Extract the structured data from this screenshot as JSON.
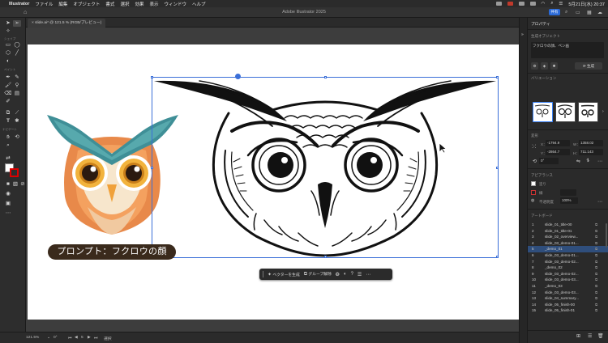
{
  "menubar": {
    "app": "Illustrator",
    "items": [
      "ファイル",
      "編集",
      "オブジェクト",
      "書式",
      "選択",
      "効果",
      "表示",
      "ウィンドウ",
      "ヘルプ"
    ],
    "clock": "5月21日(水) 20:37"
  },
  "window": {
    "title": "Adobe Illustrator 2025",
    "share_label": "共有"
  },
  "document_tab": {
    "label": "slide.ai* @ 121.5 % (RGB/プレビュー)"
  },
  "toolbar": {
    "section_labels": [
      "シェイプ",
      "ペイント",
      "ナビゲート"
    ]
  },
  "canvas": {
    "prompt_text": "プロンプト：フクロウの顔"
  },
  "context_bar": {
    "generate_vector_label": "ベクターを生成",
    "ungroup_label": "グループ解除"
  },
  "statusbar": {
    "zoom": "121.5%",
    "rotation": "0°",
    "artboard_index": "5",
    "tool_name": "選択"
  },
  "panel": {
    "title": "プロパティ",
    "section_generative": "生成オブジェクト",
    "prompt_field": "フクロウの顔、ペン画",
    "generate_button": "生成",
    "variations_label": "バリエーション",
    "transform_label": "変形",
    "transform": {
      "x_label": "X：",
      "x": "-1794.9",
      "w_label": "W：",
      "w": "1358.02",
      "y_label": "Y：",
      "y": "-2864.7",
      "h_label": "H：",
      "h": "711.143",
      "angle": "0°"
    },
    "appearance_label": "アピアランス",
    "fill_label": "塗り",
    "stroke_label": "線",
    "opacity_label": "不透明度",
    "opacity": "100%",
    "artboards_label": "アートボード",
    "artboards": [
      {
        "num": "1",
        "name": "slide_01_title-00"
      },
      {
        "num": "2",
        "name": "slide_01_title-01"
      },
      {
        "num": "3",
        "name": "slide_02_overview..."
      },
      {
        "num": "4",
        "name": "slide_03_demo-01..."
      },
      {
        "num": "5",
        "name": "_demo_01"
      },
      {
        "num": "6",
        "name": "slide_03_demo-01..."
      },
      {
        "num": "7",
        "name": "slide_03_demo-02..."
      },
      {
        "num": "8",
        "name": "_demo_02"
      },
      {
        "num": "9",
        "name": "slide_03_demo-02..."
      },
      {
        "num": "10",
        "name": "slide_03_demo-03..."
      },
      {
        "num": "11",
        "name": "_demo_03"
      },
      {
        "num": "12",
        "name": "slide_03_demo-03..."
      },
      {
        "num": "13",
        "name": "slide_04_summary..."
      },
      {
        "num": "14",
        "name": "slide_05_finish-00"
      },
      {
        "num": "15",
        "name": "slide_05_finish-01"
      }
    ],
    "selected_artboard": "5"
  },
  "colors": {
    "accent": "#3b6fd8",
    "owl_teal": "#3f8f97",
    "owl_orange": "#e8894a",
    "pill_bg": "#3a2a1c"
  }
}
